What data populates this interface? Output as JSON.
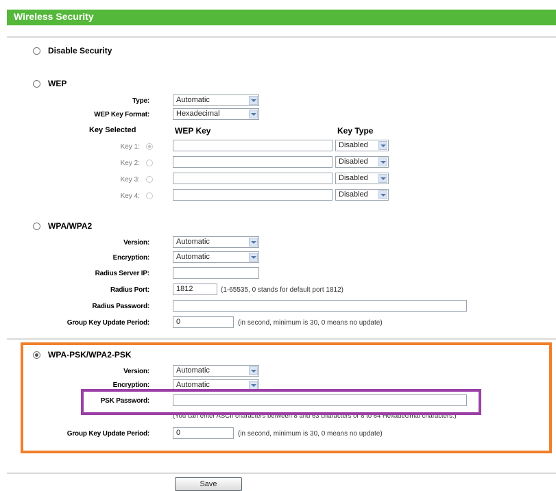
{
  "header": {
    "title": "Wireless Security"
  },
  "sections": {
    "disable": {
      "label": "Disable Security"
    },
    "wep": {
      "label": "WEP",
      "type_label": "Type:",
      "type_value": "Automatic",
      "format_label": "WEP Key Format:",
      "format_value": "Hexadecimal",
      "col_key_selected": "Key Selected",
      "col_wep_key": "WEP Key",
      "col_key_type": "Key Type",
      "keys": [
        {
          "label": "Key 1:",
          "type": "Disabled"
        },
        {
          "label": "Key 2:",
          "type": "Disabled"
        },
        {
          "label": "Key 3:",
          "type": "Disabled"
        },
        {
          "label": "Key 4:",
          "type": "Disabled"
        }
      ]
    },
    "wpa": {
      "label": "WPA/WPA2",
      "version_label": "Version:",
      "version_value": "Automatic",
      "encryption_label": "Encryption:",
      "encryption_value": "Automatic",
      "radius_ip_label": "Radius Server IP:",
      "radius_port_label": "Radius Port:",
      "radius_port_value": "1812",
      "radius_port_hint": "(1-65535, 0 stands for default port 1812)",
      "radius_password_label": "Radius Password:",
      "group_key_label": "Group Key Update Period:",
      "group_key_value": "0",
      "group_key_hint": "(in second, minimum is 30, 0 means no update)"
    },
    "wpa_psk": {
      "label": "WPA-PSK/WPA2-PSK",
      "version_label": "Version:",
      "version_value": "Automatic",
      "encryption_label": "Encryption:",
      "encryption_value": "Automatic",
      "psk_label": "PSK Password:",
      "psk_hint": "(You can enter ASCII characters between 8 and 63 characters or 8 to 64 Hexadecimal characters.)",
      "group_key_label": "Group Key Update Period:",
      "group_key_value": "0",
      "group_key_hint": "(in second, minimum is 30, 0 means no update)"
    }
  },
  "footer": {
    "save_label": "Save"
  },
  "colors": {
    "header_green": "#54b83a",
    "highlight_orange": "#f07f2a",
    "highlight_purple": "#9b3fa6"
  }
}
